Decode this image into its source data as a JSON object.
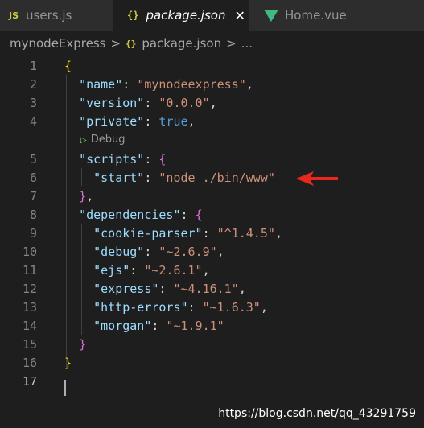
{
  "tabs": [
    {
      "icon": "JS",
      "label": "users.js",
      "active": false
    },
    {
      "icon": "{}",
      "label": "package.json",
      "active": true,
      "close": "✕"
    },
    {
      "icon": "vue-icon",
      "label": "Home.vue",
      "active": false
    }
  ],
  "breadcrumb": {
    "items": [
      "mynodeExpress",
      "package.json",
      "..."
    ],
    "separator": ">",
    "file_icon": "{}"
  },
  "editor": {
    "line_numbers": [
      "1",
      "2",
      "3",
      "4",
      "5",
      "6",
      "7",
      "8",
      "9",
      "10",
      "11",
      "12",
      "13",
      "14",
      "15",
      "16",
      "17"
    ],
    "active_line": "17",
    "codelens": {
      "play": "▷",
      "label": "Debug"
    },
    "code": {
      "l1_brace": "{",
      "name_key": "\"name\"",
      "name_val": "\"mynodeexpress\"",
      "version_key": "\"version\"",
      "version_val": "\"0.0.0\"",
      "private_key": "\"private\"",
      "private_val": "true",
      "scripts_key": "\"scripts\"",
      "scripts_open": "{",
      "start_key": "\"start\"",
      "start_val": "\"node ./bin/www\"",
      "scripts_close": "}",
      "deps_key": "\"dependencies\"",
      "deps_open": "{",
      "dep1_key": "\"cookie-parser\"",
      "dep1_val": "\"^1.4.5\"",
      "dep2_key": "\"debug\"",
      "dep2_val": "\"~2.6.9\"",
      "dep3_key": "\"ejs\"",
      "dep3_val": "\"~2.6.1\"",
      "dep4_key": "\"express\"",
      "dep4_val": "\"~4.16.1\"",
      "dep5_key": "\"http-errors\"",
      "dep5_val": "\"~1.6.3\"",
      "dep6_key": "\"morgan\"",
      "dep6_val": "\"~1.9.1\"",
      "deps_close": "}",
      "l16_brace": "}"
    }
  },
  "watermark": "https://blog.csdn.net/qq_43291759",
  "colors": {
    "accent_arrow": "#e8281e",
    "key": "#9cdcfe",
    "string": "#ce9178",
    "keyword": "#569cd6"
  }
}
